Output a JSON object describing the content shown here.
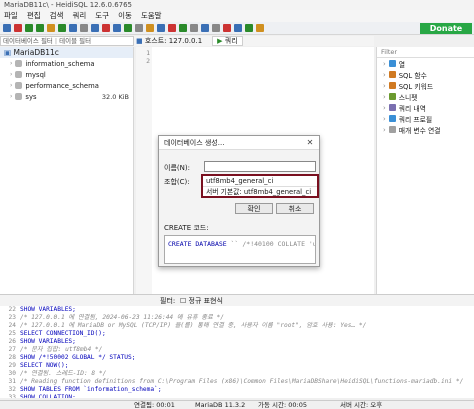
{
  "window": {
    "title": "MariaDB11c\\ - HeidiSQL 12.6.0.6765"
  },
  "menu": [
    "파일",
    "편집",
    "검색",
    "쿼리",
    "도구",
    "이동",
    "도움말"
  ],
  "donate_label": "Donate",
  "session": {
    "name": "MariaDB11c"
  },
  "filters": {
    "db_filter": "데이터베이스 필터",
    "table_filter": "테이블 필터"
  },
  "tabs": [
    {
      "label": "호스트: 127.0.0.1"
    },
    {
      "label": "쿼리"
    }
  ],
  "tree": {
    "root": "MariaDB11c",
    "items": [
      {
        "name": "information_schema",
        "size": ""
      },
      {
        "name": "mysql",
        "size": ""
      },
      {
        "name": "performance_schema",
        "size": ""
      },
      {
        "name": "sys",
        "size": "32.0 KiB"
      }
    ]
  },
  "editor": {
    "line_numbers": [
      "1",
      "2"
    ]
  },
  "right_panel": {
    "filter_placeholder": "Filter",
    "items": [
      "열",
      "SQL 함수",
      "SQL 키워드",
      "스니펫",
      "쿼리 내역",
      "쿼리 프로필",
      "매개 변수 연결"
    ],
    "colors": [
      "#3a8fd6",
      "#d07a22",
      "#d07a22",
      "#6b9a2f",
      "#7a6fb0",
      "#3a8fd6",
      "#a0a0a0"
    ]
  },
  "dialog": {
    "title": "데이터베이스 생성...",
    "name_label": "이름(N):",
    "name_value": "",
    "collation_label": "조합(C):",
    "collation_value": "utf8mb4_general_ci",
    "collation_default": "서버 기본값: utf8mb4_general_ci",
    "ok_label": "확인",
    "cancel_label": "취소",
    "code_label": "CREATE 코드:",
    "code_keyword": "CREATE DATABASE",
    "code_rest": "`` /*!40100 COLLATE 'utf8m"
  },
  "bottom": {
    "filter_label": "필터:",
    "regex_label": "정규 표현식"
  },
  "log": [
    {
      "num": "22",
      "text": "SHOW VARIABLES;",
      "type": "sql"
    },
    {
      "num": "23",
      "text": "/* 127.0.0.1 에 연결됨, 2024-06-23 11:26:44 에 유휴 종료 */",
      "type": "comment"
    },
    {
      "num": "24",
      "text": "/* 127.0.0.1 에 MariaDB or MySQL (TCP/IP) 을(를) 통해 연결 중, 사용자 이름 \"root\", 암호 사용: Yes… */",
      "type": "comment"
    },
    {
      "num": "25",
      "text": "SELECT CONNECTION_ID();",
      "type": "sql"
    },
    {
      "num": "26",
      "text": "SHOW VARIABLES;",
      "type": "sql"
    },
    {
      "num": "27",
      "text": "/* 문자 집합: utf8mb4 */",
      "type": "comment"
    },
    {
      "num": "28",
      "text": "SHOW /*!50002 GLOBAL */ STATUS;",
      "type": "sql"
    },
    {
      "num": "29",
      "text": "SELECT NOW();",
      "type": "sql"
    },
    {
      "num": "30",
      "text": "/* 연결됨. 스레드-ID: 8 */",
      "type": "comment"
    },
    {
      "num": "31",
      "text": "/* Reading function definitions from C:\\Program Files (x86)\\Common Files\\MariaDBShare\\HeidiSQL\\functions-mariadb.ini */",
      "type": "comment"
    },
    {
      "num": "32",
      "text": "SHOW TABLES FROM `information_schema`;",
      "type": "sql"
    },
    {
      "num": "33",
      "text": "SHOW COLLATION;",
      "type": "sql"
    }
  ],
  "status": [
    {
      "text": "연결됨: 00:01"
    },
    {
      "text": "MariaDB 11.3.2"
    },
    {
      "text": "가동 시간: 00:05"
    },
    {
      "text": "서버 시간: 오후"
    }
  ],
  "toolbar_colors": [
    "#3a6fb5",
    "#c33",
    "#2a8a2a",
    "#2a8a2a",
    "#d09020",
    "#2a8a2a",
    "#3a6fb5",
    "#888",
    "#3a6fb5",
    "#c33",
    "#3a6fb5",
    "#2a8a2a",
    "#888",
    "#d09020",
    "#3a6fb5",
    "#c33",
    "#2a8a2a",
    "#888",
    "#3a6fb5",
    "#888",
    "#c33",
    "#3a6fb5",
    "#2a8a2a",
    "#d09020"
  ]
}
